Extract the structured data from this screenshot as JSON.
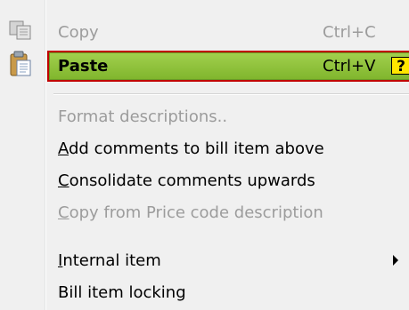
{
  "menu": {
    "items": [
      {
        "label": "Copy",
        "shortcut": "Ctrl+C",
        "enabled": false
      },
      {
        "label": "Paste",
        "shortcut": "Ctrl+V",
        "enabled": true,
        "highlighted": true,
        "help_badge": "?"
      },
      {
        "label": "Format descriptions..",
        "enabled": false
      },
      {
        "label": "Add comments to bill item above",
        "mnemonic": "A",
        "rest": "dd comments to bill item above",
        "enabled": true
      },
      {
        "label": "Consolidate comments upwards",
        "mnemonic": "C",
        "rest": "onsolidate comments upwards",
        "enabled": true
      },
      {
        "label": "Copy from Price code description",
        "mnemonic": "C",
        "rest": "opy from Price code description",
        "enabled": false
      },
      {
        "label": "Internal item",
        "mnemonic": "I",
        "rest": "nternal item",
        "enabled": true,
        "submenu": true
      },
      {
        "label": "Bill item locking",
        "enabled": true
      }
    ]
  },
  "icons": {
    "copy": "copy-icon",
    "paste": "paste-icon",
    "submenu": "submenu-arrow-icon"
  },
  "colors": {
    "highlight": "#8fc33a",
    "highlight_border": "#c00000",
    "help_badge": "#ffe600",
    "disabled_text": "#9c9c9c"
  }
}
